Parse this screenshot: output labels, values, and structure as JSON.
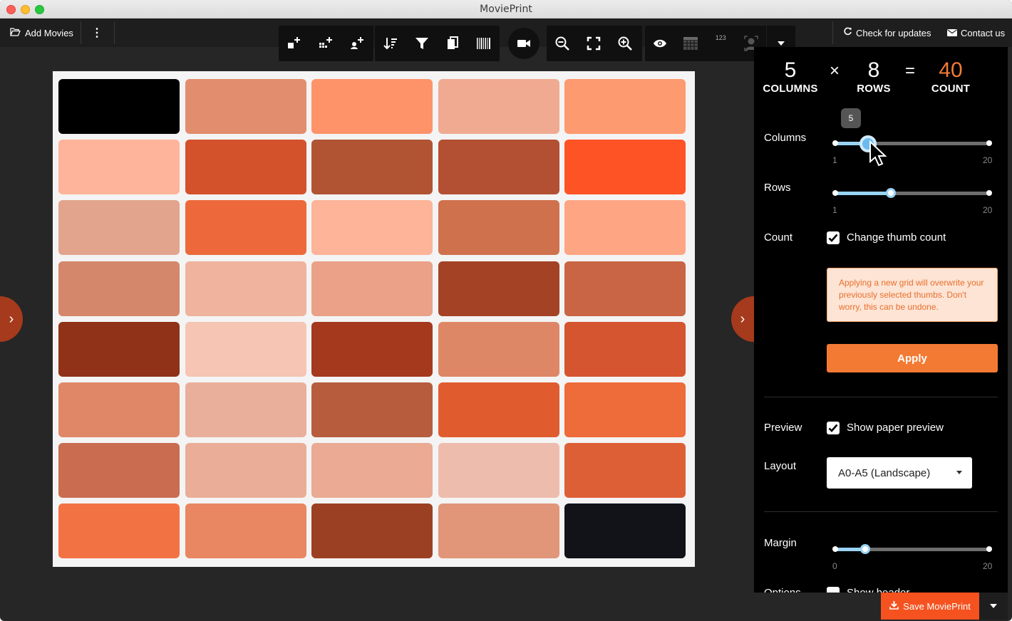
{
  "window": {
    "title": "MoviePrint"
  },
  "topbar": {
    "add_movies": "Add Movies",
    "check_updates": "Check for updates",
    "contact_us": "Contact us"
  },
  "toolbar": {
    "icons": [
      "add-thumb-before-icon",
      "add-thumb-grid-icon",
      "add-thumb-face-icon",
      "sort-icon",
      "filter-icon",
      "copy-icon",
      "barcode-icon",
      "video-camera-icon",
      "zoom-out-icon",
      "fit-screen-icon",
      "zoom-in-icon",
      "eye-icon",
      "grid-table-icon",
      "frame-number-icon",
      "face-icon",
      "dropdown-arrow-icon"
    ],
    "frame_number_label": "123"
  },
  "grid_preview": {
    "columns": 5,
    "rows": 8,
    "thumb_colors": [
      "#000000",
      "#e28d6d",
      "#fe936a",
      "#f0aa91",
      "#fe9a70",
      "#fdb49a",
      "#d3522b",
      "#b05434",
      "#b34f32",
      "#fe5324",
      "#e2a48d",
      "#ed693b",
      "#fdb499",
      "#d0714d",
      "#fea584",
      "#d4876a",
      "#f0b39e",
      "#eaa187",
      "#a44226",
      "#c96444",
      "#8f3217",
      "#f6c5b3",
      "#a5391e",
      "#de8767",
      "#d45530",
      "#e08767",
      "#eaaf9a",
      "#b75c3d",
      "#e05c2f",
      "#ee6b3a",
      "#c96c50",
      "#eaad97",
      "#eaaa94",
      "#eebcad",
      "#dd5f36",
      "#f27244",
      "#e88761",
      "#9c4023",
      "#e19579",
      "#111318"
    ]
  },
  "panel": {
    "columns_value": "5",
    "columns_label": "COLUMNS",
    "times": "×",
    "rows_value": "8",
    "rows_label": "ROWS",
    "equals": "=",
    "count_value": "40",
    "count_label": "COUNT",
    "columns_slider": {
      "label": "Columns",
      "min": "1",
      "max": "20",
      "value": 5,
      "tooltip": "5"
    },
    "rows_slider": {
      "label": "Rows",
      "min": "1",
      "max": "20",
      "value": 8
    },
    "count": {
      "label": "Count",
      "checkbox_label": "Change thumb count",
      "checked": true
    },
    "warning": "Applying a new grid will overwrite your previously selected thumbs. Don't worry, this can be undone.",
    "apply_label": "Apply",
    "preview": {
      "label": "Preview",
      "checkbox_label": "Show paper preview",
      "checked": true
    },
    "layout": {
      "label": "Layout",
      "selected": "A0-A5 (Landscape)"
    },
    "margin_slider": {
      "label": "Margin",
      "min": "0",
      "max": "20",
      "value": 4
    },
    "options_label": "Options",
    "show_header_label": "Show header"
  },
  "footer": {
    "save_label": "Save MoviePrint"
  }
}
